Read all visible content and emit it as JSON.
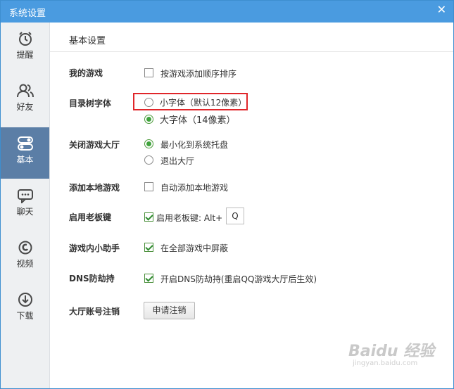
{
  "window": {
    "title": "系统设置",
    "close_glyph": "✕"
  },
  "sidebar": {
    "items": [
      {
        "label": "提醒",
        "icon": "alarm-clock-icon"
      },
      {
        "label": "好友",
        "icon": "friends-icon"
      },
      {
        "label": "基本",
        "icon": "toggle-switch-icon",
        "active": true
      },
      {
        "label": "聊天",
        "icon": "chat-bubble-icon"
      },
      {
        "label": "视频",
        "icon": "video-icon"
      },
      {
        "label": "下载",
        "icon": "download-icon"
      }
    ]
  },
  "main": {
    "section_title": "基本设置",
    "my_games": {
      "label": "我的游戏",
      "option": "按游戏添加顺序排序",
      "checked": false
    },
    "tree_font": {
      "label": "目录树字体",
      "options": [
        {
          "label": "小字体（默认12像素）",
          "checked": false
        },
        {
          "label": "大字体（14像素）",
          "checked": true
        }
      ]
    },
    "close_lobby": {
      "label": "关闭游戏大厅",
      "options": [
        {
          "label": "最小化到系统托盘",
          "checked": true
        },
        {
          "label": "退出大厅",
          "checked": false
        }
      ]
    },
    "add_local": {
      "label": "添加本地游戏",
      "option": "自动添加本地游戏",
      "checked": false
    },
    "boss_key": {
      "label": "启用老板键",
      "option": "启用老板键: Alt+",
      "key": "Q",
      "checked": true
    },
    "assistant": {
      "label": "游戏内小助手",
      "option": "在全部游戏中屏蔽",
      "checked": true
    },
    "dns": {
      "label": "DNS防劫持",
      "option": "开启DNS防劫持(重启QQ游戏大厅后生效)",
      "checked": true
    },
    "account": {
      "label": "大厅账号注销",
      "button": "申请注销"
    }
  },
  "watermark": {
    "text": "Baidu 经验",
    "sub": "jingyan.baidu.com"
  },
  "colors": {
    "titlebar": "#4a9be0",
    "active_nav": "#5b7ea6",
    "highlight_box": "#e0262a",
    "check": "#3fa33c"
  }
}
